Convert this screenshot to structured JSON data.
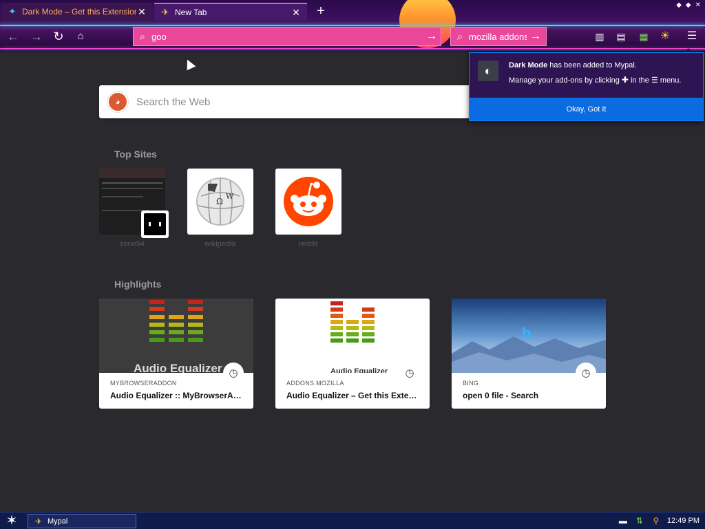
{
  "tabs": [
    {
      "title": "Dark Mode – Get this Extension fo",
      "icon": "puzzle-icon",
      "active": false
    },
    {
      "title": "New Tab",
      "icon": "mypal-icon",
      "active": true
    }
  ],
  "toolbar": {
    "url_value": "goo",
    "search_value": "mozilla addons"
  },
  "content": {
    "search_placeholder": "Search the Web",
    "top_sites_title": "Top Sites",
    "top_sites": [
      {
        "label": "zone94"
      },
      {
        "label": "wikipedia"
      },
      {
        "label": "reddit"
      }
    ],
    "highlights_title": "Highlights",
    "highlights": [
      {
        "source": "MYBROWSERADDON",
        "title": "Audio Equalizer :: MyBrowserAd...",
        "image_text": "Audio Equalizer"
      },
      {
        "source": "ADDONS.MOZILLA",
        "title": "Audio Equalizer – Get this Extens...",
        "image_text": "Audio Equalizer"
      },
      {
        "source": "BING",
        "title": "open 0 file - Search"
      }
    ]
  },
  "popup": {
    "addon_name": "Dark Mode",
    "line1_rest": " has been added to Mypal.",
    "line2_start": "Manage your add-ons by clicking ",
    "line2_mid": " in the ",
    "line2_end": " menu.",
    "button_label": "Okay, Got It"
  },
  "taskbar": {
    "app_label": "Mypal",
    "time": "12:49 PM"
  },
  "colors": {
    "accent_pink": "#e8479a",
    "popup_bg": "#2c1552",
    "popup_button": "#0a6ce0",
    "reddit": "#ff4500",
    "page_bg": "#2a2a2e"
  }
}
